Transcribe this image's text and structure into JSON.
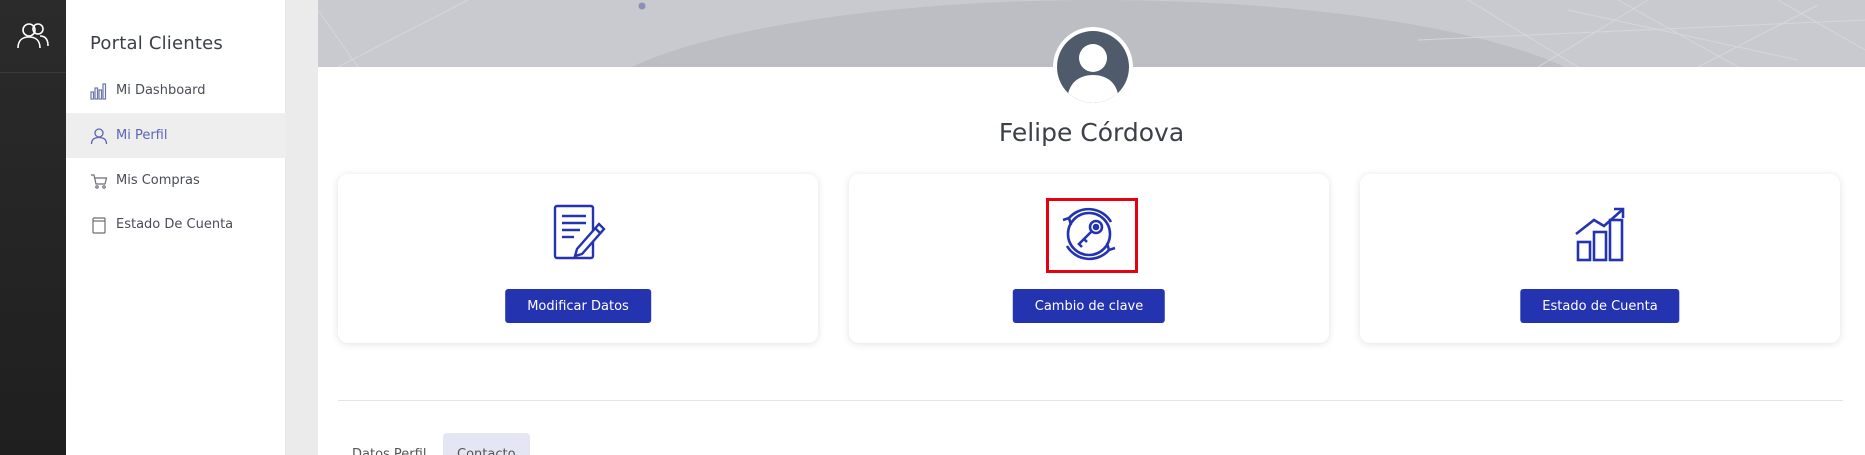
{
  "app": {
    "logo_icon": "users-icon"
  },
  "sidebar": {
    "title": "Portal Clientes",
    "items": [
      {
        "label": "Mi Dashboard",
        "icon": "bar-chart-icon",
        "active": false
      },
      {
        "label": "Mi Perfil",
        "icon": "user-icon",
        "active": true
      },
      {
        "label": "Mis Compras",
        "icon": "cart-icon",
        "active": false
      },
      {
        "label": "Estado De Cuenta",
        "icon": "document-icon",
        "active": false
      }
    ]
  },
  "profile": {
    "name": "Felipe Córdova",
    "avatar_icon": "user-avatar-icon"
  },
  "cards": [
    {
      "button_label": "Modificar Datos",
      "icon": "edit-document-icon"
    },
    {
      "button_label": "Cambio de clave",
      "icon": "key-refresh-icon",
      "highlighted": true
    },
    {
      "button_label": "Estado de Cuenta",
      "icon": "growth-chart-icon"
    }
  ],
  "tabs": [
    {
      "label": "Datos Perfil",
      "active": false
    },
    {
      "label": "Contacto",
      "active": true
    }
  ],
  "colors": {
    "accent": "#2434b0",
    "highlight": "#e60012",
    "rail": "#222222",
    "active_nav_text": "#5b64b5"
  }
}
